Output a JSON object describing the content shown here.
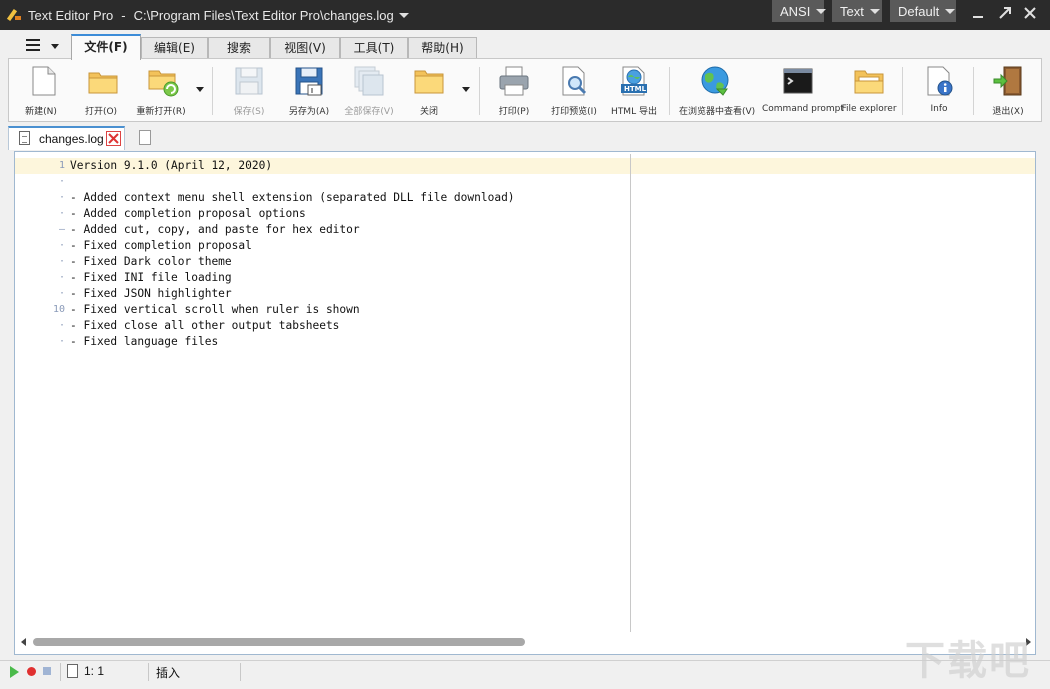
{
  "window": {
    "app_title": "Text Editor Pro",
    "separator": "-",
    "file_path": "C:\\Program Files\\Text Editor Pro\\changes.log",
    "encoding": "ANSI",
    "highlighter": "Text",
    "layout": "Default"
  },
  "menu": {
    "tabs": [
      {
        "label": "文件(F)",
        "active": true
      },
      {
        "label": "编辑(E)",
        "active": false
      },
      {
        "label": "搜索",
        "active": false
      },
      {
        "label": "视图(V)",
        "active": false
      },
      {
        "label": "工具(T)",
        "active": false
      },
      {
        "label": "帮助(H)",
        "active": false
      }
    ]
  },
  "ribbon": {
    "buttons": [
      {
        "label": "新建(N)",
        "icon": "new-file-icon",
        "enabled": true
      },
      {
        "label": "打开(O)",
        "icon": "open-folder-icon",
        "enabled": true
      },
      {
        "label": "重新打开(R)",
        "icon": "reopen-folder-icon",
        "enabled": true
      },
      {
        "label": "保存(S)",
        "icon": "save-icon",
        "enabled": false
      },
      {
        "label": "另存为(A)",
        "icon": "save-as-icon",
        "enabled": true
      },
      {
        "label": "全部保存(V)",
        "icon": "save-all-icon",
        "enabled": false
      },
      {
        "label": "关闭",
        "icon": "close-folder-icon",
        "enabled": true
      },
      {
        "label": "打印(P)",
        "icon": "printer-icon",
        "enabled": true
      },
      {
        "label": "打印预览(I)",
        "icon": "print-preview-icon",
        "enabled": true
      },
      {
        "label": "HTML 导出",
        "icon": "html-export-icon",
        "enabled": true
      },
      {
        "label": "在浏览器中查看(V)",
        "icon": "globe-icon",
        "enabled": true
      },
      {
        "label": "Command prompt",
        "icon": "terminal-icon",
        "enabled": true
      },
      {
        "label": "File explorer",
        "icon": "file-explorer-icon",
        "enabled": true
      },
      {
        "label": "Info",
        "icon": "info-icon",
        "enabled": true
      },
      {
        "label": "退出(X)",
        "icon": "exit-door-icon",
        "enabled": true
      }
    ],
    "html_badge": "HTML"
  },
  "file_tabs": [
    {
      "name": "changes.log",
      "active": true
    }
  ],
  "editor": {
    "lines": [
      {
        "num": "1",
        "text": "Version 9.1.0 (April 12, 2020)"
      },
      {
        "num": "·",
        "text": ""
      },
      {
        "num": "·",
        "text": "- Added context menu shell extension (separated DLL file download)"
      },
      {
        "num": "·",
        "text": "- Added completion proposal options"
      },
      {
        "num": "–",
        "text": "- Added cut, copy, and paste for hex editor"
      },
      {
        "num": "·",
        "text": "- Fixed completion proposal"
      },
      {
        "num": "·",
        "text": "- Fixed Dark color theme"
      },
      {
        "num": "·",
        "text": "- Fixed INI file loading"
      },
      {
        "num": "·",
        "text": "- Fixed JSON highlighter"
      },
      {
        "num": "10",
        "text": "- Fixed vertical scroll when ruler is shown"
      },
      {
        "num": "·",
        "text": "- Fixed close all other output tabsheets"
      },
      {
        "num": "·",
        "text": "- Fixed language files"
      }
    ]
  },
  "status": {
    "cursor_position": "1: 1",
    "insert_mode": "插入"
  },
  "watermark": "下载吧"
}
